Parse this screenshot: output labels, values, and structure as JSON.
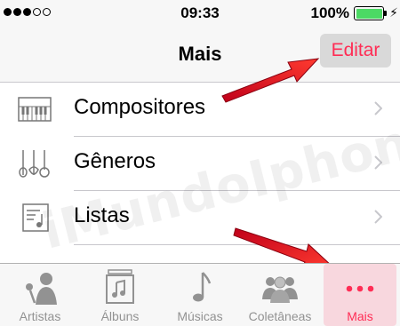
{
  "status_bar": {
    "time": "09:33",
    "battery_percent": "100%",
    "signal_full": 3,
    "signal_empty": 2,
    "battery_color": "#4cd964"
  },
  "nav": {
    "title": "Mais",
    "edit_label": "Editar",
    "accent": "#ff2d55"
  },
  "list": {
    "items": [
      {
        "label": "Compositores",
        "icon": "piano-icon"
      },
      {
        "label": "Gêneros",
        "icon": "instruments-icon"
      },
      {
        "label": "Listas",
        "icon": "playlist-icon"
      }
    ]
  },
  "watermark": "iMundoIphone.com",
  "tabs": [
    {
      "label": "Artistas",
      "icon": "artist-icon"
    },
    {
      "label": "Álbuns",
      "icon": "album-icon"
    },
    {
      "label": "Músicas",
      "icon": "music-note-icon"
    },
    {
      "label": "Coletâneas",
      "icon": "compilations-icon"
    },
    {
      "label": "Mais",
      "icon": "more-dots-icon",
      "active": true
    }
  ]
}
